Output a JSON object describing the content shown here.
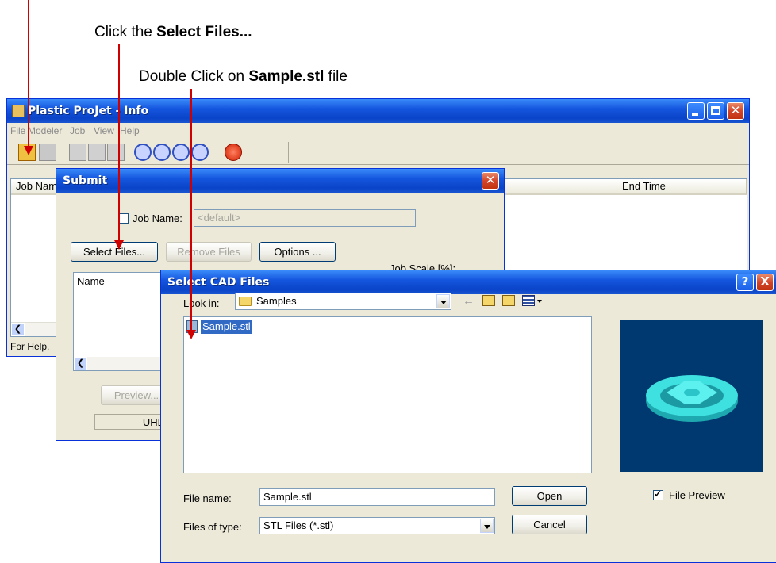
{
  "instructions": {
    "step1_prefix": "Click the ",
    "step1_bold": "Select Files...",
    "step2_prefix": "Double Click on ",
    "step2_bold": "Sample.stl",
    "step2_suffix": " file"
  },
  "main_window": {
    "title": "Plastic ProJet - Info",
    "menu": [
      "File",
      "Modeler",
      "Job",
      "View",
      "Help"
    ],
    "columns": [
      "Job Name",
      "End Time"
    ],
    "status_text": "For Help,"
  },
  "submit_dialog": {
    "title": "Submit",
    "job_name_label": "Job Name:",
    "job_name_value": "<default>",
    "select_files_label": "Select Files...",
    "remove_files_label": "Remove Files",
    "options_label": "Options ...",
    "job_scale_label": "Job Scale [%]:",
    "name_column": "Name",
    "preview_label": "Preview...",
    "mode_text": "UHD"
  },
  "cad_dialog": {
    "title": "Select CAD Files",
    "look_in_label": "Look in:",
    "look_in_value": "Samples",
    "files": [
      "Sample.stl"
    ],
    "file_name_label": "File name:",
    "file_name_value": "Sample.stl",
    "file_type_label": "Files of type:",
    "file_type_value": "STL Files  (*.stl)",
    "open_label": "Open",
    "cancel_label": "Cancel",
    "file_preview_label": "File Preview",
    "file_preview_checked": true,
    "help_glyph": "?",
    "close_glyph": "X"
  },
  "colors": {
    "titlebar": "#0a44c8",
    "annotation_arrow": "#d00000",
    "preview_bg": "#003870",
    "model": "#3fe0e0",
    "selection": "#316ac5"
  }
}
